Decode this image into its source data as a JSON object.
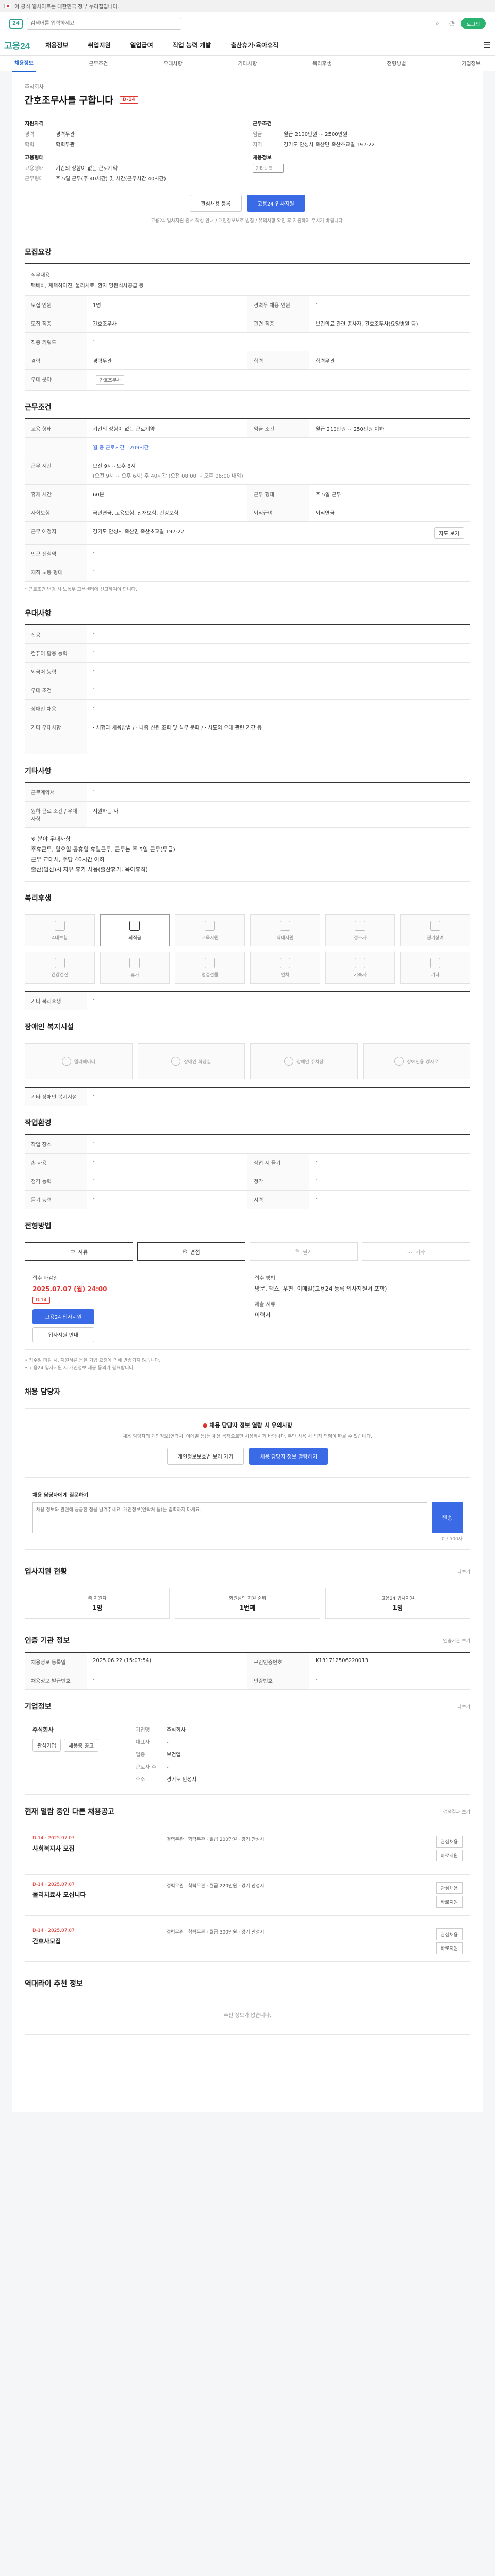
{
  "topbar": {
    "text": "이 공식 웹사이트는 대한민국 정부 누리집입니다."
  },
  "search": {
    "placeholder": "검색어를 입력하세요",
    "login": "로그인"
  },
  "gnb": {
    "logo": "고용24",
    "menu": [
      "채용정보",
      "취업지원",
      "일업급여",
      "직업 능력 개발",
      "출산휴가·육아휴직"
    ]
  },
  "subnav": [
    "채용정보",
    "근무조건",
    "우대사항",
    "기타사항",
    "복리후생",
    "전형방법",
    "기업정보"
  ],
  "hero": {
    "company": "주식회사",
    "title": "간호조무사를 구합니다",
    "badge": "D-14",
    "left_title": "지원자격",
    "left_rows": [
      [
        "경력",
        "경력무관"
      ],
      [
        "학력",
        "학력무관"
      ]
    ],
    "left_title2": "고용형태",
    "left_rows2": [
      [
        "고용형태",
        "기간의 정함이 없는 근로계약"
      ],
      [
        "근무형태",
        "주 5일 근무(주 40시간) 및 시간(근무시간 40시간)"
      ]
    ],
    "right_title": "근무조건",
    "right_rows": [
      [
        "임금",
        "월급 2100만원 ~ 2500만원"
      ],
      [
        "지역",
        "경기도 안성시 죽산면 죽산초교길 197-22"
      ]
    ],
    "right_title2": "채용정보",
    "right_rows2": [
      [
        "",
        "기타내역"
      ]
    ],
    "btn_interest": "관심채용 등록",
    "btn_apply": "고용24 입사지원",
    "note": "고용24 입사지원 원서 작성 안내 / 개인정보보호 방침 / 유의사항 확인 후 지원하여 주시기 바랍니다."
  },
  "recruit": {
    "title": "모집요강",
    "duty_label": "직무내용",
    "duty_text": "택배하, 재택하이진, 물리치료, 환자 영원식사공급 등",
    "rows": [
      [
        "모집 인원",
        "1명",
        "경력무 채용 인원",
        "-"
      ],
      [
        "모집 직종",
        "간호조무사",
        "관련 직종",
        "보건의료 관련 종사자, 간호조무사(요양병원 등)"
      ],
      [
        "직종 키워드",
        "-",
        "",
        ""
      ],
      [
        "경력",
        "경력무관",
        "학력",
        "학력무관"
      ],
      [
        "우대 분야",
        "",
        "",
        " "
      ]
    ],
    "cert_chip": "간호조무사"
  },
  "conditions": {
    "title": "근무조건",
    "rows": [
      [
        "고용 형태",
        "기간의 정함이 없는 근로계약",
        "임금 조건",
        "월급 210만원 ~ 250만원 이하"
      ],
      [
        "근무 시간",
        "오전 9시~오후 6시",
        "",
        ""
      ],
      [
        "휴게 시간",
        "60분",
        "근무 형태",
        "주 5일 근무"
      ],
      [
        "사회보험",
        "국민연금, 고용보험, 산재보험, 건강보험",
        "퇴직급여",
        "퇴직연금"
      ],
      [
        "근무 예정지",
        "경기도 안성시 죽산면 죽산초교길 197-22",
        "",
        ""
      ],
      [
        "인근 전철역",
        "-",
        "",
        ""
      ],
      [
        "재직 노동 형태",
        "-",
        "",
        ""
      ]
    ],
    "wage_sub": "월 총 근로시간 : 209시간",
    "time_text": "(오전 9시 ~ 오후 6시)  주 40시간 (오전 08:00 ~ 오후 06:00 내외)",
    "map_button": "지도 보기",
    "footnote": "* 근로조건 변경 시 노동부 고용센터에 신고하여야 합니다."
  },
  "prefs": {
    "title": "우대사항",
    "rows": [
      [
        "전공",
        "-"
      ],
      [
        "컴퓨터 활용 능력",
        "-"
      ],
      [
        "외국어 능력",
        "-"
      ],
      [
        "우대 조건",
        "-"
      ],
      [
        "장애인 채용",
        "-"
      ],
      [
        "기타 우대사항",
        "· 시험과 채용방법 / · 나중 신원 조회 및 실무 문화 / · 시도의 우대 관련 기간 등"
      ]
    ]
  },
  "etc": {
    "title": "기타사항",
    "rows": [
      [
        "근로계약서",
        "-"
      ],
      [
        "원하 근로 조건 / 우대 사항",
        "지원하는 자"
      ]
    ],
    "notes": [
      "※ 분야 우대사항",
      "주휴근무, 일요일·공휴일 휴일근무, 근무는 주 5일 근무(무급)",
      "근무 교대시, 주당 40시간 이하",
      "출산(임신)시 자유 휴가 사용(출산휴가, 육아휴직)"
    ]
  },
  "welfare": {
    "title": "복리후생",
    "items": [
      "4대보험",
      "퇴직금",
      "교육지원",
      "식대지원",
      "경조사",
      "정기상여",
      "건강검진",
      "휴가",
      "명절선물",
      "연차",
      "기숙사",
      "기타"
    ],
    "on_index": 1,
    "footer_label": "기타 복리후생",
    "footer_value": "-"
  },
  "disability": {
    "title": "장애인 복지시설",
    "items": [
      "엘리베이터",
      "장애인 화장실",
      "장애인 주차장",
      "장애인용 경사로"
    ],
    "footer_label": "기타 장애인 복지시설",
    "footer_value": "-"
  },
  "env": {
    "title": "작업환경",
    "rows": [
      [
        "작업 장소",
        "-",
        "",
        ""
      ],
      [
        "손 사용",
        "-",
        "작업 시 들기",
        "-"
      ],
      [
        "청각 능력",
        "-",
        "청각",
        "-"
      ],
      [
        "듣기 능력",
        "-",
        "시력",
        "-"
      ]
    ]
  },
  "apply": {
    "title": "전형방법",
    "tabs": [
      "서류",
      "면접",
      "필기",
      "기타"
    ],
    "period_label": "접수 마감일",
    "period_date": "2025.07.07 (월) 24:00",
    "period_badge": "D-14",
    "btn1": "고용24 입사지원",
    "btn2": "입사지원 안내",
    "method_label": "접수 방법",
    "method_value": "방문, 팩스, 우편, 이메일(고용24 등록 입사지원서 포함)",
    "doc_label": "제출 서류",
    "doc_value": "이력서",
    "notes": [
      "• 접수일 마감 시, 지원서류 등은 기업 요청에 의해 반송되지 않습니다.",
      "• 고용24 입사지원 시 개인정보 제공 동의가 필요합니다."
    ]
  },
  "manager": {
    "title": "채용 담당자",
    "warn1": "채용 담당자 정보 열람 시 유의사항",
    "desc": "채용 담당자의 개인정보(연락처, 이메일 등)는 채용 목적으로만 사용하시기 바랍니다. 무단 사용 시 법적 책임이 따를 수 있습니다.",
    "btn1": "개인정보보호법 보러 가기",
    "btn2": "채용 담당자 정보 열람하기"
  },
  "qna": {
    "title": "채용 담당자에게 질문하기",
    "placeholder": "채용 정보와 관련해 궁금한 점을 남겨주세요. 개인정보(연락처 등)는 입력하지 마세요.",
    "counter": "0 / 500자",
    "send": "전송"
  },
  "status": {
    "title": "입사지원 현황",
    "more": "더보기",
    "items": [
      [
        "총 지원자",
        "1명"
      ],
      [
        "회원님의 지원 순위",
        "1번째"
      ],
      [
        "고용24 입사지원",
        "1명"
      ]
    ]
  },
  "source": {
    "title": "인증 기관 정보",
    "more": "인증기관 보기",
    "rows": [
      [
        "채용정보 등록일",
        "2025.06.22 (15:07:54)",
        "구인인증번호",
        "K131712506220013"
      ],
      [
        "채용정보 발급번호",
        "-",
        "인증번호",
        "-"
      ]
    ]
  },
  "company": {
    "title": "기업정보",
    "more": "더보기",
    "name": "주식회사",
    "rows": [
      [
        "기업명",
        "주식회사"
      ],
      [
        "대표자",
        "-"
      ],
      [
        "업종",
        "보건업"
      ],
      [
        "근로자 수",
        "-"
      ],
      [
        "주소",
        "경기도 안성시"
      ]
    ],
    "btn1": "관심기업",
    "btn2": "채용중 공고"
  },
  "related": {
    "title": "현재 열람 중인 다른 채용공고",
    "more": "검색결과 보기",
    "items": [
      {
        "dday": "D-14 · 2025.07.07",
        "title": "사회복지사 모집",
        "desc": "경력무관 · 학력무관 · 월급 200만원 · 경기 안성시"
      },
      {
        "dday": "D-14 · 2025.07.07",
        "title": "물리치료사 모십니다",
        "desc": "경력무관 · 학력무관 · 월급 220만원 · 경기 안성시"
      },
      {
        "dday": "D-14 · 2025.07.07",
        "title": "간호사모집",
        "desc": "경력무관 · 학력무관 · 월급 300만원 · 경기 안성시"
      }
    ],
    "btn1": "관심채용",
    "btn2": "바로지원"
  },
  "bottom": {
    "title": "역대라이 추천 정보",
    "empty": "추천 정보가 없습니다."
  },
  "colors": {
    "accent": "#3b6ae6",
    "danger": "#e1332e",
    "brand": "#0b4fa8"
  }
}
